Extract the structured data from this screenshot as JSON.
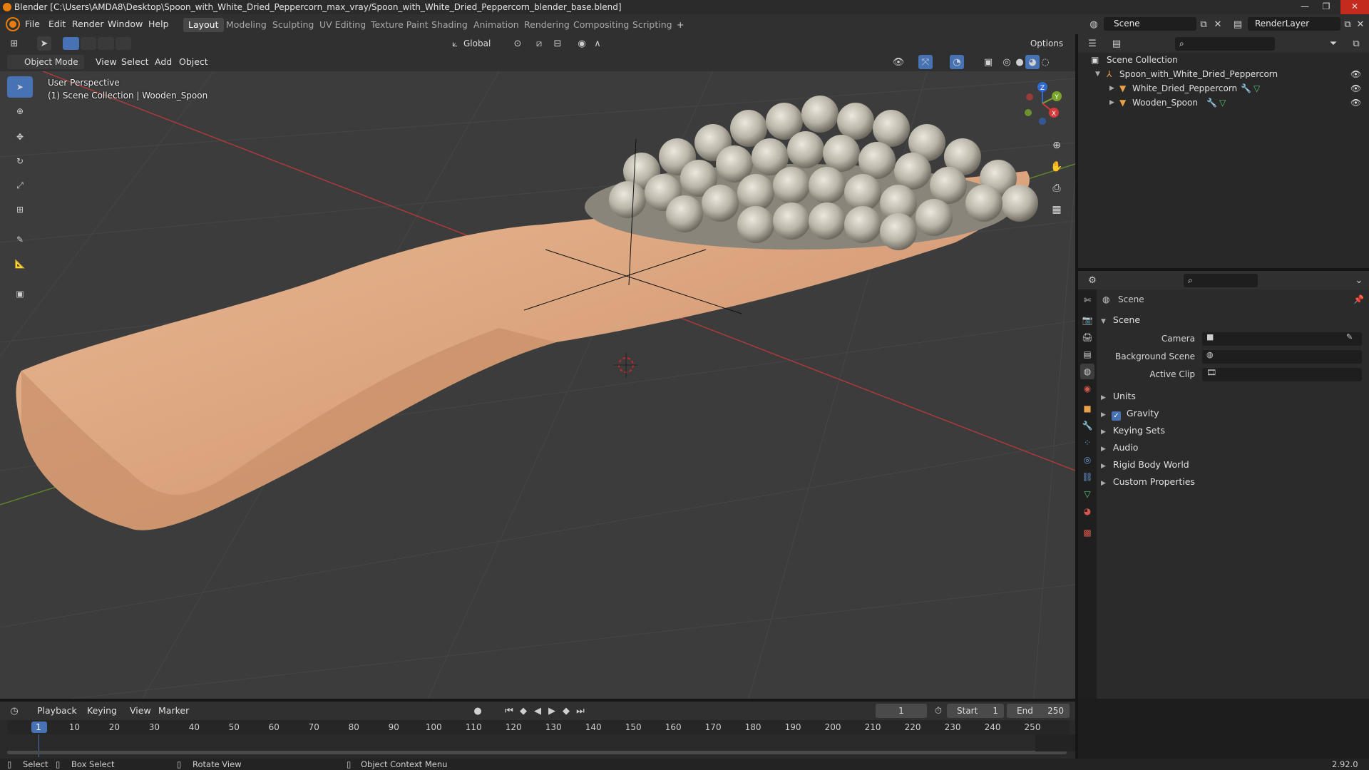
{
  "window": {
    "title": "Blender [C:\\Users\\AMDA8\\Desktop\\Spoon_with_White_Dried_Peppercorn_max_vray/Spoon_with_White_Dried_Peppercorn_blender_base.blend]",
    "minimize": "—",
    "maximize": "❐",
    "close": "✕"
  },
  "menubar": {
    "items": [
      "File",
      "Edit",
      "Render",
      "Window",
      "Help"
    ],
    "workspaces": [
      "Layout",
      "Modeling",
      "Sculpting",
      "UV Editing",
      "Texture Paint",
      "Shading",
      "Animation",
      "Rendering",
      "Compositing",
      "Scripting"
    ],
    "active_workspace": "Layout",
    "add_workspace": "+",
    "scene_name": "Scene",
    "render_layer": "RenderLayer"
  },
  "tool_header": {
    "orientation": "Global",
    "options": "Options"
  },
  "viewport_header": {
    "mode": "Object Mode",
    "menus": [
      "View",
      "Select",
      "Add",
      "Object"
    ]
  },
  "viewport": {
    "perspective_label": "User Perspective",
    "collection_label": "(1) Scene Collection | Wooden_Spoon",
    "gizmo": {
      "x": "X",
      "y": "Y",
      "z": "Z"
    }
  },
  "outliner": {
    "root": "Scene Collection",
    "collection": "Spoon_with_White_Dried_Peppercorn",
    "objects": [
      "White_Dried_Peppercorn",
      "Wooden_Spoon"
    ]
  },
  "properties": {
    "context": "Scene",
    "panel_title": "Scene",
    "fields": [
      {
        "label": "Camera"
      },
      {
        "label": "Background Scene"
      },
      {
        "label": "Active Clip"
      }
    ],
    "sections": [
      "Units",
      "Gravity",
      "Keying Sets",
      "Audio",
      "Rigid Body World",
      "Custom Properties"
    ],
    "gravity_checked": true
  },
  "timeline": {
    "menus": [
      "Playback",
      "Keying",
      "View",
      "Marker"
    ],
    "current_frame": "1",
    "start_label": "Start",
    "start": "1",
    "end_label": "End",
    "end": "250",
    "ruler": [
      "1",
      "10",
      "20",
      "30",
      "40",
      "50",
      "60",
      "70",
      "80",
      "90",
      "100",
      "110",
      "120",
      "130",
      "140",
      "150",
      "160",
      "170",
      "180",
      "190",
      "200",
      "210",
      "220",
      "230",
      "240",
      "250"
    ]
  },
  "statusbar": {
    "select": "Select",
    "box_select": "Box Select",
    "rotate_view": "Rotate View",
    "context_menu": "Object Context Menu",
    "version": "2.92.0"
  },
  "colors": {
    "accent": "#4772b3",
    "axis_x": "#c73b3b",
    "axis_y": "#6b9a2a",
    "wood": "#d9a57f"
  }
}
